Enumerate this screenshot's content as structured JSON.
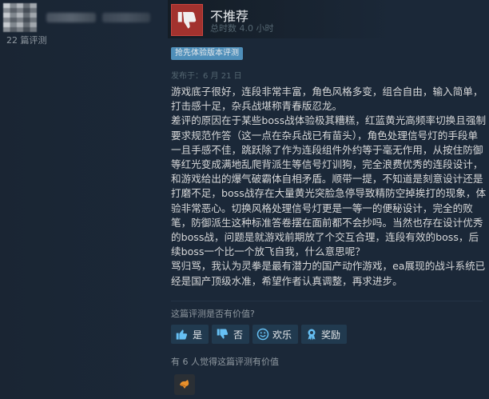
{
  "reviewer": {
    "review_count": "22 篇评测"
  },
  "review": {
    "recommendation": "不推荐",
    "hours": "总时数 4.0 小时",
    "early_access_badge": "抢先体验版本评测",
    "posted": "发布于：6 月 21 日",
    "paragraphs": [
      "游戏底子很好，连段非常丰富，角色风格多变，组合自由，输入简单，打击感十足，杂兵战堪称青春版忍龙。",
      "差评的原因在于某些boss战体验极其糟糕，红蓝黄光高频率切换且强制要求规范作答（这一点在杂兵战已有苗头），角色处理信号灯的手段单一且手感不佳，跳跃除了作为连段组件外约等于毫无作用，从按住防御等红光变成满地乱爬背派生等信号灯训狗，完全浪费优秀的连段设计，和游戏给出的爆气破霸体自相矛盾。顺带一提，不知道是刻意设计还是打磨不足，boss战存在大量黄光突脸急停导致精防空掉挨打的现象，体验非常恶心。切换风格处理信号灯更是一等一的便秘设计，完全的败笔，防御派生这种标准答卷摆在面前都不会抄吗。当然也存在设计优秀的boss战，问题是就游戏前期放了个交互合理，连段有效的boss，后续boss一个比一个放飞自我，什么意思呢？",
      "骂归骂，我认为灵拳是最有潜力的国产动作游戏，ea展现的战斗系统已经是国产顶级水准，希望作者认真调整，再求进步。"
    ]
  },
  "feedback": {
    "question": "这篇评测是否有价值?",
    "yes_label": "是",
    "no_label": "否",
    "funny_label": "欢乐",
    "award_label": "奖励",
    "helpful_count": "有 6 人觉得这篇评测有价值"
  },
  "colors": {
    "background": "#1b2838",
    "thumb_down": "#a2322e",
    "badge": "#4f8fba",
    "link": "#66c0f4"
  },
  "icons": {
    "thumb": "thumbs-down-icon",
    "yes": "thumbs-up-icon",
    "no": "thumbs-down-icon",
    "funny": "smiley-icon",
    "award": "award-icon"
  }
}
